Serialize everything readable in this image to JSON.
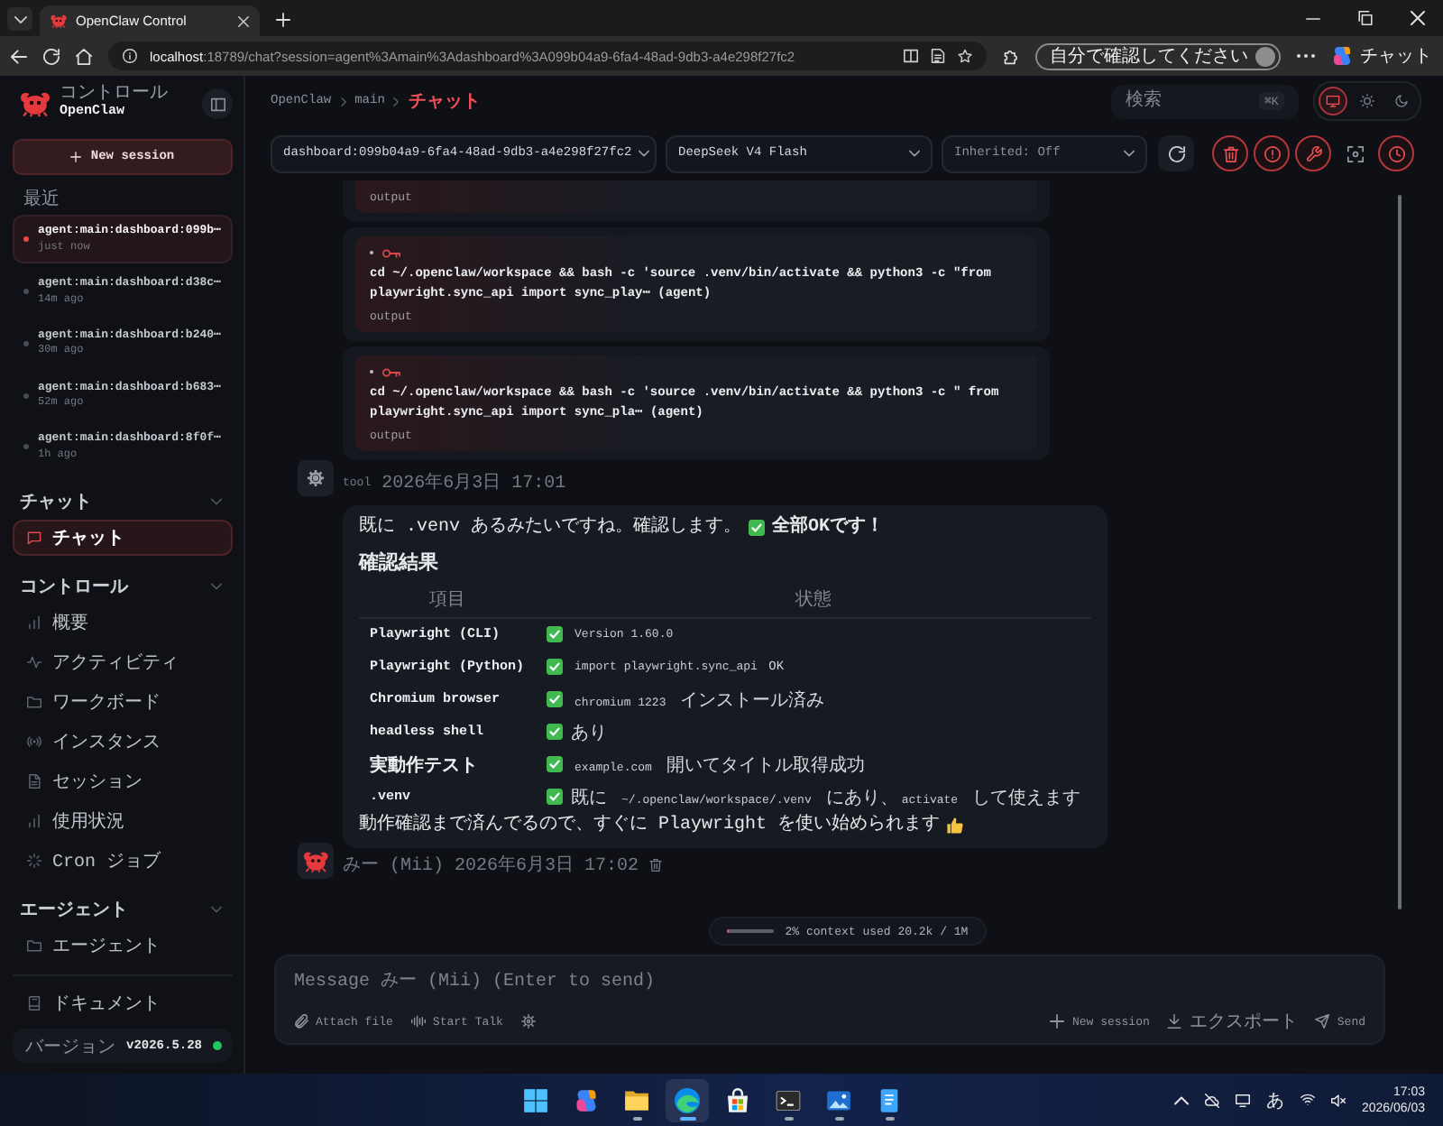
{
  "browser": {
    "tabs": [
      {
        "title": "OpenClaw Control",
        "selected": true
      }
    ],
    "url": {
      "host": "localhost",
      "rest": ":18789/chat?session=agent%3Amain%3Adashboard%3A099b04a9-6fa4-48ad-9db3-a4e298f27fc2"
    },
    "profile": "自分で確認してください",
    "copilot": "チャット"
  },
  "sidebar": {
    "brand": {
      "caption": "コントロール",
      "name": "OpenClaw"
    },
    "new_session": "New session",
    "recent_label": "最近",
    "sessions": [
      {
        "name": "agent:main:dashboard:099b⋯",
        "time": "just now",
        "selected": true
      },
      {
        "name": "agent:main:dashboard:d38c⋯",
        "time": "14m ago",
        "selected": false
      },
      {
        "name": "agent:main:dashboard:b240⋯",
        "time": "30m ago",
        "selected": false
      },
      {
        "name": "agent:main:dashboard:b683⋯",
        "time": "52m ago",
        "selected": false
      },
      {
        "name": "agent:main:dashboard:8f0f⋯",
        "time": "1h ago",
        "selected": false
      }
    ],
    "sections": [
      {
        "title": "チャット",
        "expanded": true,
        "items": [
          {
            "label": "チャット",
            "selected": true
          }
        ]
      },
      {
        "title": "コントロール",
        "expanded": true,
        "items": [
          {
            "label": "概要",
            "selected": false
          },
          {
            "label": "アクティビティ",
            "selected": false
          },
          {
            "label": "ワークボード",
            "selected": false
          },
          {
            "label": "インスタンス",
            "selected": false
          },
          {
            "label": "セッション",
            "selected": false
          },
          {
            "label": "使用状況",
            "selected": false
          },
          {
            "label": "Cron ジョブ",
            "selected": false
          }
        ]
      },
      {
        "title": "エージェント",
        "expanded": true,
        "items": [
          {
            "label": "エージェント",
            "selected": false
          }
        ]
      }
    ],
    "docs": "ドキュメント",
    "version": {
      "label": "バージョン",
      "value": "v2026.5.28",
      "connected": true
    }
  },
  "header": {
    "breadcrumb": [
      {
        "label": "OpenClaw",
        "selected": false
      },
      {
        "label": "main",
        "selected": false
      },
      {
        "label": "チャット",
        "selected": true
      }
    ],
    "search": {
      "placeholder": "検索",
      "shortcut": "⌘K"
    },
    "theme_modes": [
      {
        "selected": true
      },
      {
        "selected": false
      },
      {
        "selected": false
      }
    ]
  },
  "toolbar": {
    "session": "dashboard:099b04a9-6fa4-48ad-9db3-a4e298f27fc2",
    "model": "DeepSeek V4 Flash",
    "thinking": "Inherited: Off",
    "toggles": [
      {
        "on": true
      },
      {
        "on": true
      },
      {
        "on": true
      },
      {
        "on": false
      },
      {
        "on": true
      }
    ]
  },
  "chat": {
    "tool_cards": [
      {
        "output": "output"
      },
      {
        "command": "cd ~/.openclaw/workspace && bash -c 'source .venv/bin/activate && python3 -c \"from playwright.sync_api import sync_play⋯ (agent)",
        "output": "output"
      },
      {
        "command": "cd ~/.openclaw/workspace && bash -c 'source .venv/bin/activate && python3 -c \" from playwright.sync_api import sync_pla⋯ (agent)",
        "output": "output"
      }
    ],
    "tool_meta": {
      "sender": "tool",
      "time": "2026年6月3日 17:01"
    },
    "reply": {
      "intro": "既に .venv あるみたいですね。確認します。",
      "intro_strong": "全部OKです！",
      "heading": "確認結果",
      "columns": [
        "項目",
        "状態"
      ],
      "rows": [
        {
          "item": "Playwright (CLI)",
          "ok": true,
          "status": [
            {
              "kind": "code",
              "text": "Version 1.60.0"
            }
          ]
        },
        {
          "item": "Playwright (Python)",
          "ok": true,
          "status": [
            {
              "kind": "code",
              "text": "import playwright.sync_api"
            },
            {
              "kind": "text",
              "text": " OK"
            }
          ]
        },
        {
          "item": "Chromium browser",
          "ok": true,
          "status": [
            {
              "kind": "code",
              "text": "chromium 1223"
            },
            {
              "kind": "text",
              "text": " インストール済み"
            }
          ]
        },
        {
          "item": "headless shell",
          "ok": true,
          "status": [
            {
              "kind": "text",
              "text": "あり"
            }
          ]
        },
        {
          "item": "実動作テスト",
          "ok": true,
          "status": [
            {
              "kind": "code",
              "text": "example.com"
            },
            {
              "kind": "text",
              "text": " 開いてタイトル取得成功"
            }
          ]
        },
        {
          "item": ".venv",
          "ok": true,
          "status": [
            {
              "kind": "text",
              "text": "既に "
            },
            {
              "kind": "code",
              "text": "~/.openclaw/workspace/.venv"
            },
            {
              "kind": "text",
              "text": " にあり、"
            },
            {
              "kind": "code",
              "text": "activate"
            },
            {
              "kind": "text",
              "text": " して使えます"
            }
          ]
        }
      ],
      "outro": "動作確認まで済んでるので、すぐに Playwright を使い始められます"
    },
    "reply_meta": {
      "sender": "みー (Mii)",
      "time": "2026年6月3日 17:02"
    }
  },
  "context": {
    "level": 0.02,
    "text": "2% context used 20.2k / 1M"
  },
  "composer": {
    "placeholder": "Message みー (Mii) (Enter to send)",
    "attach": "Attach file",
    "talk": "Start Talk",
    "new_session": "New session",
    "export": "エクスポート",
    "send": "Send"
  },
  "taskbar": {
    "apps": [
      {
        "running": false,
        "selected": false
      },
      {
        "running": false,
        "selected": false
      },
      {
        "running": true,
        "selected": false
      },
      {
        "running": true,
        "selected": true
      },
      {
        "running": false,
        "selected": false
      },
      {
        "running": true,
        "selected": false
      },
      {
        "running": true,
        "selected": false
      },
      {
        "running": true,
        "selected": false
      }
    ],
    "ime": "あ",
    "time": "17:03",
    "date": "2026/06/03"
  }
}
